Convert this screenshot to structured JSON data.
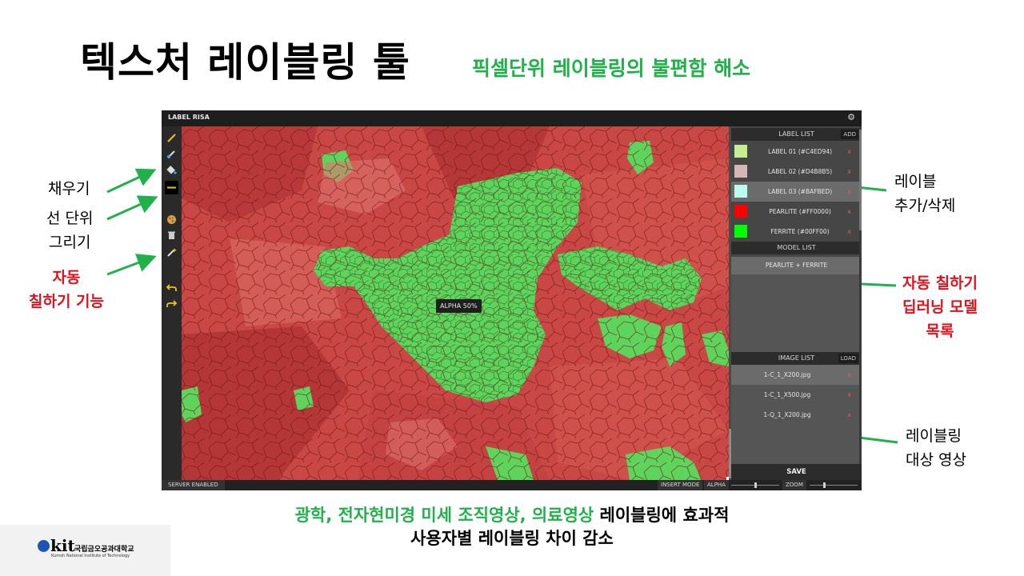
{
  "slide": {
    "title": "텍스처 레이블링 툴",
    "subtitle": "픽셀단위 레이블링의 불편함 해소",
    "caption_line1_green": "광학, 전자현미경 미세 조직영상, 의료영상",
    "caption_line1_black": " 레이블링에 효과적",
    "caption_line2": "사용자별 레이블링 차이 감소"
  },
  "annotations": {
    "fill": "채우기",
    "line_draw_1": "선 단위",
    "line_draw_2": "그리기",
    "auto_fill_1": "자동",
    "auto_fill_2": "칠하기 기능",
    "label_add_1": "레이블",
    "label_add_2": "추가/삭제",
    "model_1": "자동 칠하기",
    "model_2": "딥러닝 모델",
    "model_3": "목록",
    "image_1": "레이블링",
    "image_2": "대상 영상"
  },
  "app": {
    "title": "LABEL RISA",
    "tools": [
      "pencil-icon",
      "brush-icon",
      "fill-bucket-icon",
      "line-icon",
      "palette-icon",
      "trash-icon",
      "magic-wand-icon",
      "undo-icon",
      "redo-icon"
    ],
    "alpha_tooltip": "ALPHA 50%",
    "label_list": {
      "header": "LABEL LIST",
      "add_label": "ADD",
      "items": [
        {
          "name": "LABEL 01 (#C4ED94)",
          "color": "#C4ED94"
        },
        {
          "name": "LABEL 02 (#D4B8B5)",
          "color": "#D4B8B5"
        },
        {
          "name": "LABEL 03 (#BAFBED)",
          "color": "#BAFBED"
        },
        {
          "name": "PEARLITE (#FF0000)",
          "color": "#FF0000"
        },
        {
          "name": "FERRITE (#00FF00)",
          "color": "#00FF00"
        }
      ],
      "delete_mark": "x"
    },
    "model_list": {
      "header": "MODEL LIST",
      "items": [
        "PEARLITE + FERRITE"
      ]
    },
    "image_list": {
      "header": "IMAGE LIST",
      "load_label": "LOAD",
      "items": [
        "1-C_1_X200.jpg",
        "1-C_1_X500.jpg",
        "1-Q_1_X200.jpg"
      ]
    },
    "save_label": "SAVE",
    "status": {
      "server": "SERVER ENABLED",
      "mode": "INSERT MODE",
      "alpha_label": "ALPHA",
      "zoom_label": "ZOOM",
      "alpha_level": 0.5,
      "zoom_level": 0.3
    }
  },
  "logo": {
    "mark": "kit",
    "korean": "국립금오공과대학교",
    "english": "Kumoh National Institute of Technology"
  }
}
